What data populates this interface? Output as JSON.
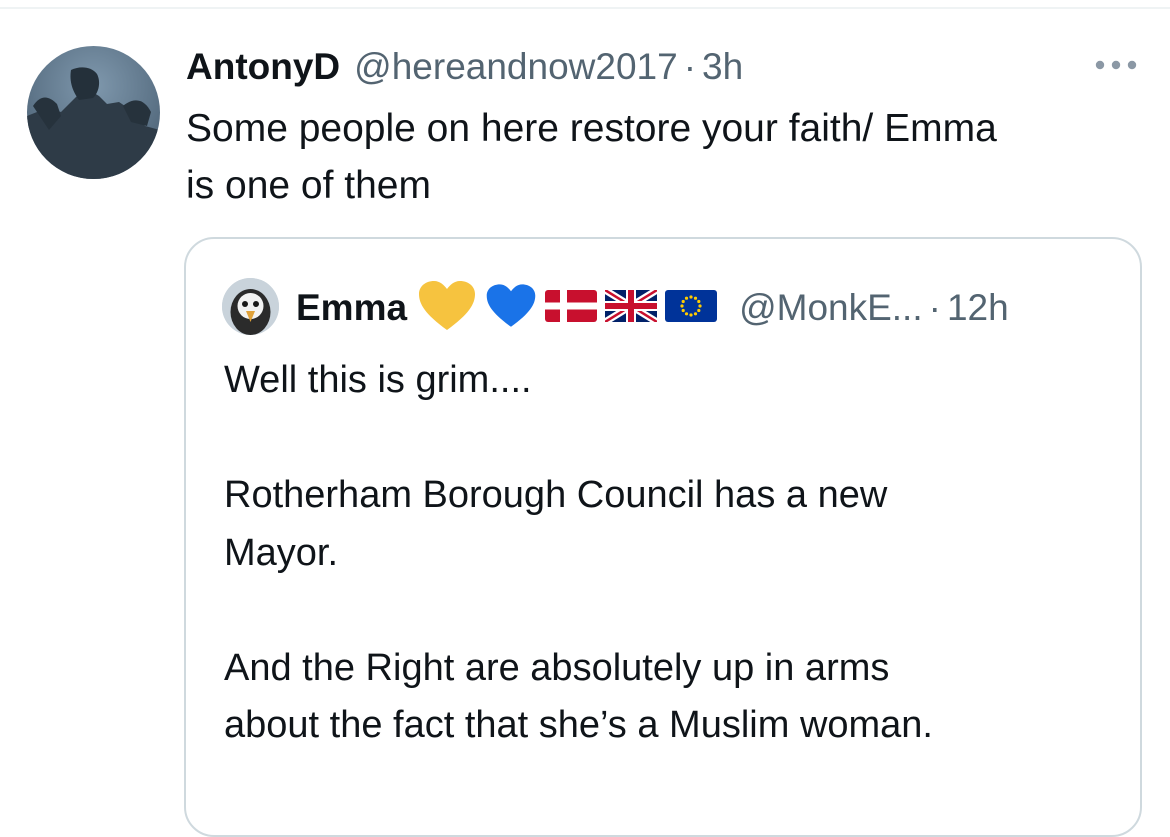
{
  "tweet": {
    "author": {
      "display_name": "AntonyD",
      "handle": "@hereandnow2017",
      "separator": "·",
      "time": "3h",
      "avatar_icon": "profile-photo"
    },
    "more_icon": "more-horizontal-icon",
    "text": "Some people on here restore your faith/ Emma\nis one of them",
    "quote": {
      "author": {
        "display_name": "Emma",
        "emoji_icons": [
          "yellow-heart",
          "blue-heart",
          "denmark-flag",
          "uk-flag",
          "eu-flag"
        ],
        "handle": "@MonkE...",
        "separator": "·",
        "time": "12h",
        "avatar_icon": "penguin-profile-photo"
      },
      "text": "Well this is grim....\n\nRotherham Borough Council has a new\nMayor.\n\nAnd the Right are absolutely up in arms\nabout the fact that she’s a Muslim woman."
    }
  },
  "colors": {
    "text_primary": "#0f1419",
    "text_secondary": "#536471",
    "border": "#cfd9de"
  }
}
